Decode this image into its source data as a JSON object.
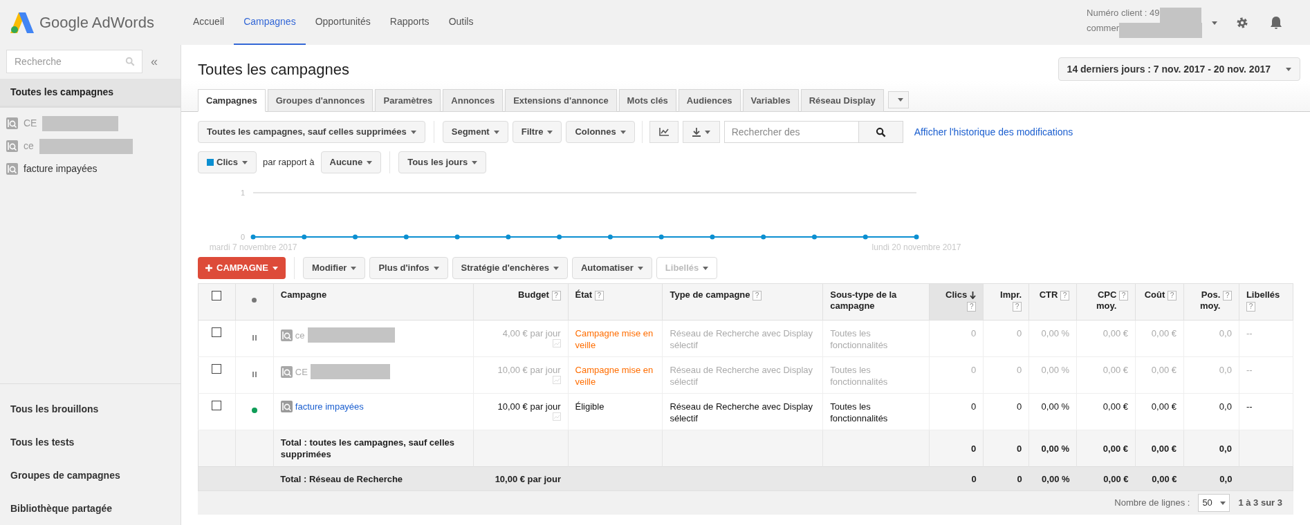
{
  "header": {
    "logo": "Google AdWords",
    "nav": [
      {
        "label": "Accueil",
        "selected": false
      },
      {
        "label": "Campagnes",
        "selected": true
      },
      {
        "label": "Opportunités",
        "selected": false
      },
      {
        "label": "Rapports",
        "selected": false
      },
      {
        "label": "Outils",
        "selected": false
      }
    ],
    "client": {
      "line1": "Numéro client : 49",
      "line2": "commer"
    }
  },
  "sidebar": {
    "search_placeholder": "Recherche",
    "collapse": "«",
    "all_campaigns": {
      "label": "Toutes les campagnes",
      "selected": true
    },
    "campaigns": [
      {
        "name": "CE"
      },
      {
        "name": "ce"
      },
      {
        "name": "facture impayées"
      }
    ],
    "bottom_links": [
      "Tous les brouillons",
      "Tous les tests",
      "Groupes de campagnes",
      "Bibliothèque partagée"
    ]
  },
  "main": {
    "title": "Toutes les campagnes",
    "date_range": "14 derniers jours : 7 nov. 2017 - 20 nov. 2017",
    "tabs": [
      {
        "label": "Campagnes",
        "selected": true
      },
      {
        "label": "Groupes d'annonces",
        "selected": false
      },
      {
        "label": "Paramètres",
        "selected": false
      },
      {
        "label": "Annonces",
        "selected": false
      },
      {
        "label": "Extensions d'annonce",
        "selected": false
      },
      {
        "label": "Mots clés",
        "selected": false
      },
      {
        "label": "Audiences",
        "selected": false
      },
      {
        "label": "Variables",
        "selected": false
      },
      {
        "label": "Réseau Display",
        "selected": false
      }
    ],
    "toolbar": {
      "filter": "Toutes les campagnes, sauf celles supprimées",
      "buttons": [
        "Segment",
        "Filtre",
        "Colonnes"
      ],
      "search_placeholder": "Rechercher des",
      "history_link": "Afficher l'historique des modifications"
    },
    "chart_controls": {
      "compare_label": "par rapport à",
      "compare": "Aucune",
      "period": "Tous les jours"
    },
    "chart_data": {
      "type": "line",
      "categories": [
        "mardi 7 novembre 2017",
        null,
        null,
        null,
        null,
        null,
        null,
        null,
        null,
        null,
        null,
        null,
        null,
        "lundi 20 novembre 2017"
      ],
      "series": [
        {
          "name": "Clics",
          "color": "#0b8fd1",
          "marker": "circle",
          "values": [
            0,
            0,
            0,
            0,
            0,
            0,
            0,
            0,
            0,
            0,
            0,
            0,
            0,
            0
          ]
        }
      ],
      "ylim": [
        0,
        1
      ],
      "yticks": [
        0,
        1
      ]
    },
    "actions": {
      "new_campaign": "CAMPAGNE",
      "buttons": [
        {
          "label": "Modifier",
          "disabled": false
        },
        {
          "label": "Plus d'infos",
          "disabled": false
        },
        {
          "label": "Stratégie d'enchères",
          "disabled": false
        },
        {
          "label": "Automatiser",
          "disabled": false
        },
        {
          "label": "Libellés",
          "disabled": true
        }
      ]
    },
    "table": {
      "select_all_checked": false,
      "columns": [
        {
          "label": "Campagne",
          "sorted": false
        },
        {
          "label": "Budget",
          "help": "?",
          "sorted": false
        },
        {
          "label": "État",
          "help": "?",
          "sorted": false
        },
        {
          "label": "Type de campagne",
          "help": "?",
          "sorted": false
        },
        {
          "label": "Sous-type de la campagne",
          "sorted": false
        },
        {
          "label": "Clics",
          "help": "?",
          "sorted": true
        },
        {
          "label": "Impr.",
          "help": "?",
          "sorted": false
        },
        {
          "label": "CTR",
          "help": "?",
          "sorted": false
        },
        {
          "label": "CPC moy.",
          "help": "?",
          "sorted": false
        },
        {
          "label": "Coût",
          "help": "?",
          "sorted": false
        },
        {
          "label": "Pos. moy.",
          "help": "?",
          "sorted": false
        },
        {
          "label": "Libellés",
          "help": "?",
          "sorted": false
        }
      ],
      "rows": [
        {
          "checked": false,
          "kind": "paused",
          "cells": [
            "ce",
            "4,00 € par jour",
            "Campagne mise en veille",
            "Réseau de Recherche avec Display sélectif",
            "Toutes les fonctionnalités",
            "0",
            "0",
            "0,00 %",
            "0,00 €",
            "0,00 €",
            "0,0",
            "--"
          ]
        },
        {
          "checked": false,
          "kind": "paused",
          "cells": [
            "CE",
            "10,00 € par jour",
            "Campagne mise en veille",
            "Réseau de Recherche avec Display sélectif",
            "Toutes les fonctionnalités",
            "0",
            "0",
            "0,00 %",
            "0,00 €",
            "0,00 €",
            "0,0",
            "--"
          ]
        },
        {
          "checked": false,
          "kind": "eligible",
          "cells": [
            "facture impayées",
            "10,00 € par jour",
            "Éligible",
            "Réseau de Recherche avec Display sélectif",
            "Toutes les fonctionnalités",
            "0",
            "0",
            "0,00 %",
            "0,00 €",
            "0,00 €",
            "0,0",
            "--"
          ]
        }
      ],
      "totals": [
        {
          "cells": [
            "Total : toutes les campagnes, sauf celles supprimées",
            null,
            null,
            null,
            null,
            "0",
            "0",
            "0,00 %",
            "0,00 €",
            "0,00 €",
            "0,0",
            null
          ]
        },
        {
          "cells": [
            "Total : Réseau de Recherche",
            "10,00 € par jour",
            null,
            null,
            null,
            "0",
            "0",
            "0,00 %",
            "0,00 €",
            "0,00 €",
            "0,0",
            null
          ]
        }
      ]
    },
    "footer": {
      "rows_label": "Nombre de lignes :",
      "rows_value": "50",
      "range": "1 à 3 sur 3"
    }
  }
}
